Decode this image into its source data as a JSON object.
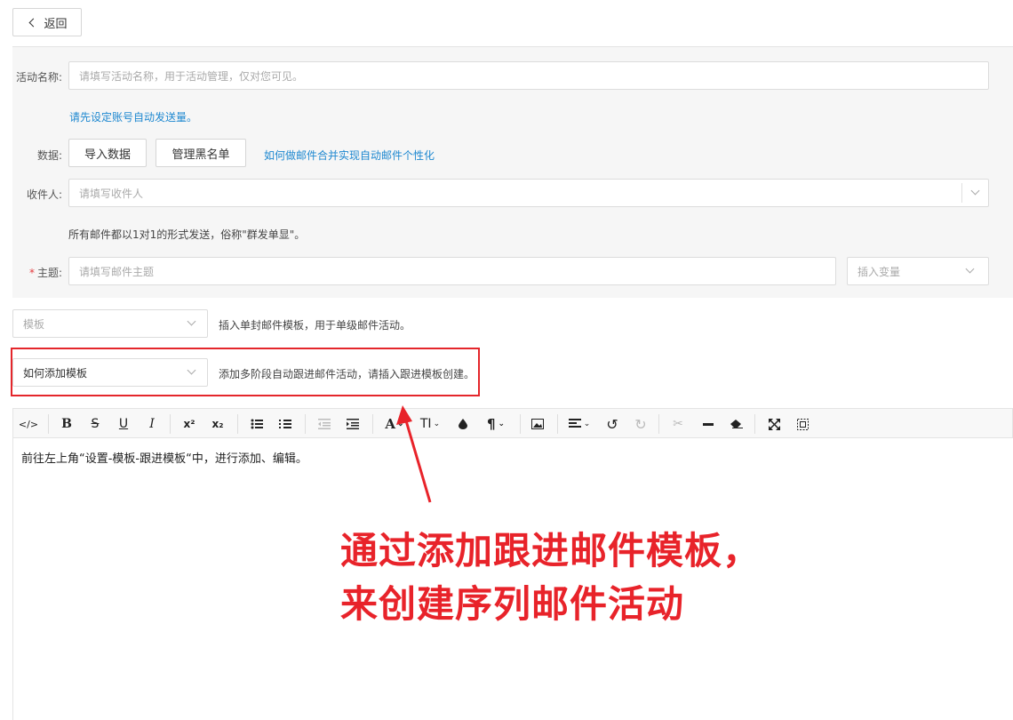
{
  "header": {
    "back_label": "返回"
  },
  "form": {
    "name_label": "活动名称:",
    "name_placeholder": "请填写活动名称，用于活动管理，仅对您可见。",
    "account_link": "请先设定账号自动发送量。",
    "data_label": "数据:",
    "import_button": "导入数据",
    "blacklist_button": "管理黑名单",
    "merge_link": "如何做邮件合并实现自动邮件个性化",
    "recipient_label": "收件人:",
    "recipient_placeholder": "请填写收件人",
    "send_note": "所有邮件都以1对1的形式发送，俗称\"群发单显\"。",
    "subject_required": "*",
    "subject_label": "主题:",
    "subject_placeholder": "请填写邮件主题",
    "insert_var_placeholder": "插入变量"
  },
  "templates": {
    "template_select": "模板",
    "template_hint": "插入单封邮件模板，用于单级邮件活动。",
    "followup_select": "如何添加模板",
    "followup_hint": "添加多阶段自动跟进邮件活动，请插入跟进模板创建。"
  },
  "toolbar": {
    "code": "</>",
    "bold": "B",
    "strike": "S",
    "underline": "U",
    "italic": "I",
    "sup": "x²",
    "sub": "x₂",
    "font_color": "A",
    "font_size": "TI",
    "paragraph": "¶"
  },
  "editor": {
    "content": "前往左上角“设置-模板-跟进模板“中，进行添加、编辑。"
  },
  "annotation": {
    "line1": "通过添加跟进邮件模板，",
    "line2": "来创建序列邮件活动",
    "color": "#e8232a"
  }
}
